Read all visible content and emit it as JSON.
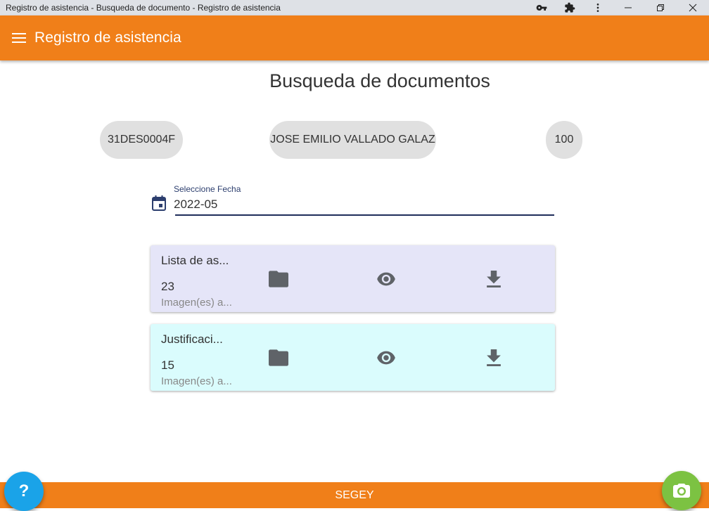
{
  "window": {
    "title": "Registro de asistencia - Busqueda de documento - Registro de asistencia",
    "icons": [
      "key-icon",
      "puzzle-icon",
      "more-vert-icon",
      "minimize-icon",
      "restore-icon",
      "close-icon"
    ]
  },
  "appbar": {
    "title": "Registro de asistencia",
    "color": "#f07f19"
  },
  "page": {
    "title": "Busqueda de documentos"
  },
  "chips": {
    "code": "31DES0004F",
    "name": "JOSE EMILIO VALLADO GALAZ",
    "number": "100"
  },
  "date_field": {
    "label": "Seleccione Fecha",
    "value": "2022-05"
  },
  "cards": [
    {
      "title": "Lista de as...",
      "count": "23",
      "subtitle": "Imagen(es) a...",
      "color": "#e5e5f8"
    },
    {
      "title": "Justificaci...",
      "count": "15",
      "subtitle": "Imagen(es) a...",
      "color": "#dafcfd"
    }
  ],
  "footer": {
    "text": "SEGEY",
    "help_label": "?",
    "help_color": "#1aa3e8",
    "camera_color": "#7cc242"
  }
}
